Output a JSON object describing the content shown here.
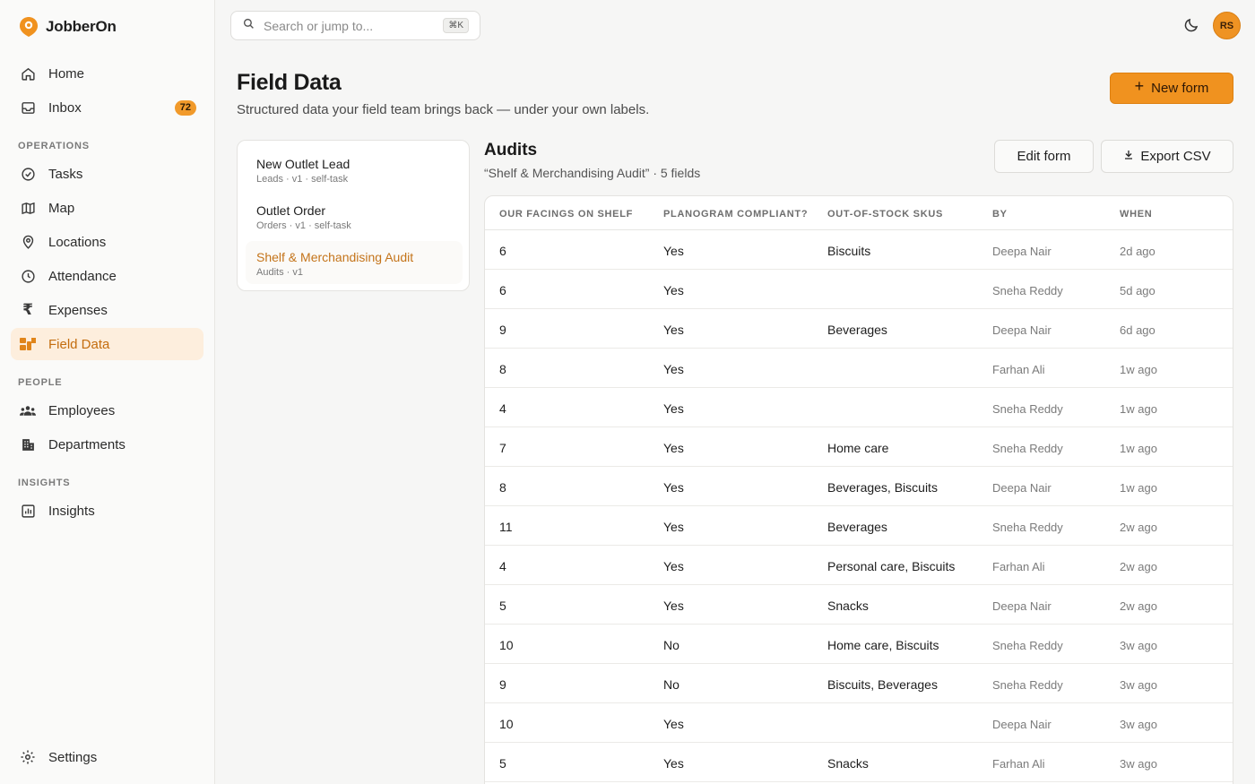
{
  "app": {
    "name": "JobberOn"
  },
  "sidebar": {
    "primary": [
      {
        "label": "Home",
        "icon": "home-icon"
      },
      {
        "label": "Inbox",
        "icon": "inbox-icon",
        "badge": "72"
      }
    ],
    "sections": [
      {
        "label": "OPERATIONS",
        "items": [
          {
            "label": "Tasks",
            "icon": "check-circle-icon"
          },
          {
            "label": "Map",
            "icon": "map-icon"
          },
          {
            "label": "Locations",
            "icon": "location-pin-icon"
          },
          {
            "label": "Attendance",
            "icon": "clock-icon"
          },
          {
            "label": "Expenses",
            "icon": "rupee-icon"
          },
          {
            "label": "Field Data",
            "icon": "field-data-icon",
            "active": true
          }
        ]
      },
      {
        "label": "PEOPLE",
        "items": [
          {
            "label": "Employees",
            "icon": "people-icon"
          },
          {
            "label": "Departments",
            "icon": "building-icon"
          }
        ]
      },
      {
        "label": "INSIGHTS",
        "items": [
          {
            "label": "Insights",
            "icon": "bar-chart-icon"
          }
        ]
      }
    ],
    "footer": {
      "label": "Settings",
      "icon": "gear-icon"
    }
  },
  "topbar": {
    "search_placeholder": "Search or jump to...",
    "search_shortcut": "⌘K",
    "theme_icon": "moon-icon",
    "avatar_initials": "RS"
  },
  "header": {
    "title": "Field Data",
    "subtitle": "Structured data your field team brings back — under your own labels.",
    "new_form_label": "New form"
  },
  "forms": [
    {
      "name": "New Outlet Lead",
      "meta": "Leads · v1 · self-task"
    },
    {
      "name": "Outlet Order",
      "meta": "Orders · v1 · self-task"
    },
    {
      "name": "Shelf & Merchandising Audit",
      "meta": "Audits · v1",
      "active": true
    }
  ],
  "detail": {
    "title": "Audits",
    "subtitle": "“Shelf & Merchandising Audit” · 5 fields",
    "edit_label": "Edit form",
    "export_label": "Export CSV"
  },
  "table": {
    "columns": [
      "OUR FACINGS ON SHELF",
      "PLANOGRAM COMPLIANT?",
      "OUT-OF-STOCK SKUS",
      "BY",
      "WHEN"
    ],
    "rows": [
      [
        "6",
        "Yes",
        "Biscuits",
        "Deepa Nair",
        "2d ago"
      ],
      [
        "6",
        "Yes",
        "",
        "Sneha Reddy",
        "5d ago"
      ],
      [
        "9",
        "Yes",
        "Beverages",
        "Deepa Nair",
        "6d ago"
      ],
      [
        "8",
        "Yes",
        "",
        "Farhan Ali",
        "1w ago"
      ],
      [
        "4",
        "Yes",
        "",
        "Sneha Reddy",
        "1w ago"
      ],
      [
        "7",
        "Yes",
        "Home care",
        "Sneha Reddy",
        "1w ago"
      ],
      [
        "8",
        "Yes",
        "Beverages, Biscuits",
        "Deepa Nair",
        "1w ago"
      ],
      [
        "11",
        "Yes",
        "Beverages",
        "Sneha Reddy",
        "2w ago"
      ],
      [
        "4",
        "Yes",
        "Personal care, Biscuits",
        "Farhan Ali",
        "2w ago"
      ],
      [
        "5",
        "Yes",
        "Snacks",
        "Deepa Nair",
        "2w ago"
      ],
      [
        "10",
        "No",
        "Home care, Biscuits",
        "Sneha Reddy",
        "3w ago"
      ],
      [
        "9",
        "No",
        "Biscuits, Beverages",
        "Sneha Reddy",
        "3w ago"
      ],
      [
        "10",
        "Yes",
        "",
        "Deepa Nair",
        "3w ago"
      ],
      [
        "5",
        "Yes",
        "Snacks",
        "Farhan Ali",
        "3w ago"
      ]
    ]
  },
  "colors": {
    "accent": "#f0921f",
    "accent_text": "#c46d0e",
    "active_bg": "#fdeedd"
  }
}
